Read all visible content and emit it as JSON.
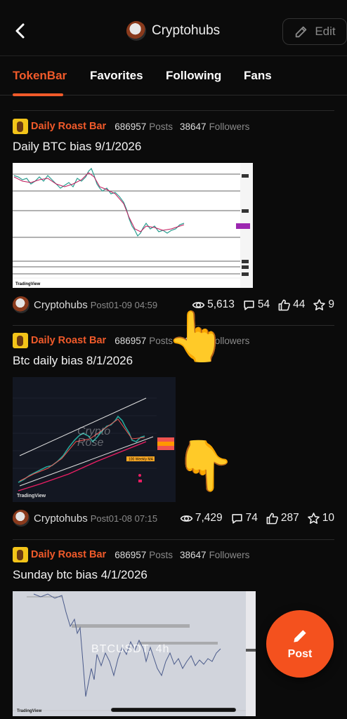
{
  "header": {
    "title": "Cryptohubs",
    "edit_label": "Edit"
  },
  "tabs": [
    {
      "label": "TokenBar",
      "active": true
    },
    {
      "label": "Favorites",
      "active": false
    },
    {
      "label": "Following",
      "active": false
    },
    {
      "label": "Fans",
      "active": false
    }
  ],
  "posts": [
    {
      "bar_name": "Daily Roast Bar",
      "posts_count": "686957",
      "posts_label": "Posts",
      "followers_count": "38647",
      "followers_label": "Followers",
      "title": "Daily BTC bias 9/1/2026",
      "author": "Cryptohubs",
      "time": "Post01-09 04:59",
      "views": "5,613",
      "comments": "54",
      "likes": "44",
      "stars": "9"
    },
    {
      "bar_name": "Daily Roast Bar",
      "posts_count": "686957",
      "posts_label": "Posts",
      "followers_count": "38647",
      "followers_label": "Followers",
      "title": "Btc daily bias 8/1/2026",
      "author": "Cryptohubs",
      "time": "Post01-08 07:15",
      "views": "7,429",
      "comments": "74",
      "likes": "287",
      "stars": "10",
      "chart_watermark": "Crypto Rose",
      "chart_tag": "100 Weekly MA"
    },
    {
      "bar_name": "Daily Roast Bar",
      "posts_count": "686957",
      "posts_label": "Posts",
      "followers_count": "38647",
      "followers_label": "Followers",
      "title": "Sunday btc bias 4/1/2026",
      "chart_watermark": "BTCUSDT, 4h"
    }
  ],
  "chart_brand": "TradingView",
  "fab": {
    "label": "Post"
  },
  "colors": {
    "accent": "#f05a2a",
    "fab": "#f4511e",
    "background": "#0b0b0b"
  },
  "icons": [
    "back-arrow-icon",
    "edit-icon",
    "eye-icon",
    "comment-icon",
    "thumbs-up-icon",
    "star-icon",
    "pencil-icon"
  ]
}
